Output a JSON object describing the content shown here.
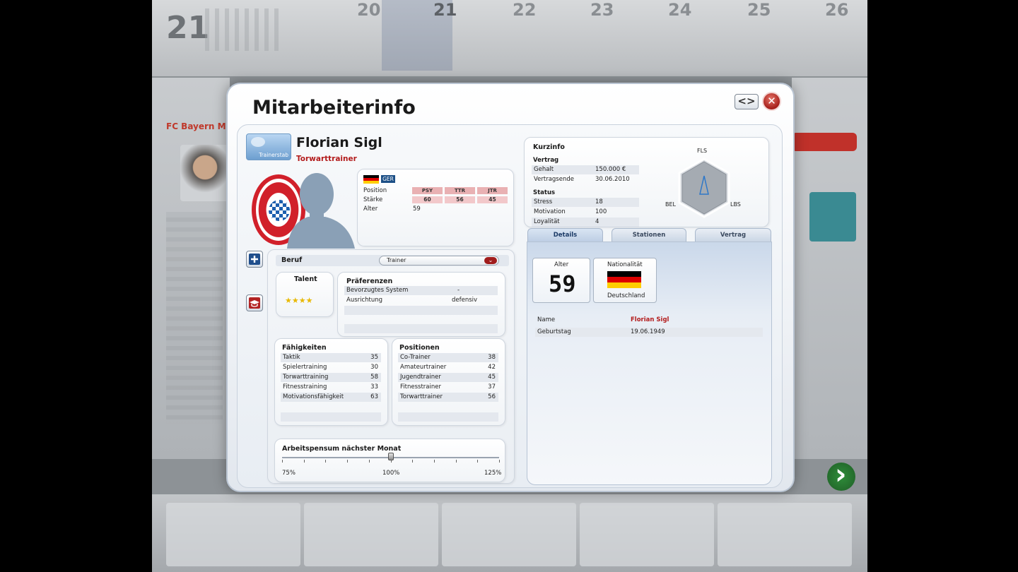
{
  "background": {
    "day_big": "21",
    "days": [
      "20",
      "21",
      "22",
      "23",
      "24",
      "25",
      "26"
    ],
    "club_title": "FC Bayern Mü"
  },
  "modal": {
    "title": "Mitarbeiterinfo",
    "nav_label": "<>",
    "close_label": "✕"
  },
  "header": {
    "badge_label": "Trainerstab",
    "name": "Florian Sigl",
    "role": "Torwarttrainer",
    "club_logo_text": "FC BAYERN MÜNCHEN"
  },
  "summary": {
    "nationality_code": "GER",
    "rows": [
      {
        "label": "Position"
      },
      {
        "label": "Stärke"
      },
      {
        "label": "Alter",
        "value": "59"
      }
    ],
    "attributes": [
      {
        "code": "PSY",
        "value": "60"
      },
      {
        "code": "TTR",
        "value": "56"
      },
      {
        "code": "JTR",
        "value": "45"
      }
    ]
  },
  "beruf": {
    "label": "Beruf",
    "value": "Trainer"
  },
  "talent": {
    "label": "Talent",
    "stars": 4,
    "stars_text": "★★★★"
  },
  "praeferenzen": {
    "title": "Präferenzen",
    "rows": [
      {
        "label": "Bevorzugtes System",
        "value": "-"
      },
      {
        "label": "Ausrichtung",
        "value": "defensiv"
      }
    ]
  },
  "faehigkeiten": {
    "title": "Fähigkeiten",
    "rows": [
      {
        "label": "Taktik",
        "value": "35"
      },
      {
        "label": "Spielertraining",
        "value": "30"
      },
      {
        "label": "Torwarttraining",
        "value": "58"
      },
      {
        "label": "Fitnesstraining",
        "value": "33"
      },
      {
        "label": "Motivationsfähigkeit",
        "value": "63"
      }
    ]
  },
  "positionen": {
    "title": "Positionen",
    "rows": [
      {
        "label": "Co-Trainer",
        "value": "38"
      },
      {
        "label": "Amateurtrainer",
        "value": "42"
      },
      {
        "label": "Jugendtrainer",
        "value": "45"
      },
      {
        "label": "Fitnesstrainer",
        "value": "37"
      },
      {
        "label": "Torwarttrainer",
        "value": "56"
      }
    ]
  },
  "arbeitspensum": {
    "title": "Arbeitspensum nächster Monat",
    "min_label": "75%",
    "mid_label": "100%",
    "max_label": "125%",
    "value_percent": 100
  },
  "kurzinfo": {
    "title": "Kurzinfo",
    "vertrag_title": "Vertrag",
    "vertrag_rows": [
      {
        "label": "Gehalt",
        "value": "150.000 €"
      },
      {
        "label": "Vertragsende",
        "value": "30.06.2010"
      }
    ],
    "status_title": "Status",
    "status_rows": [
      {
        "label": "Stress",
        "value": "18"
      },
      {
        "label": "Motivation",
        "value": "100"
      },
      {
        "label": "Loyalität",
        "value": "4"
      }
    ],
    "radar_labels": {
      "top": "FLS",
      "left": "BEL",
      "right": "LBS"
    }
  },
  "tabs": [
    {
      "label": "Details",
      "active": true
    },
    {
      "label": "Stationen",
      "active": false
    },
    {
      "label": "Vertrag",
      "active": false
    }
  ],
  "details": {
    "age_label": "Alter",
    "age_value": "59",
    "nationality_label": "Nationalität",
    "nationality_value": "Deutschland",
    "rows": [
      {
        "label": "Name",
        "value": "Florian Sigl"
      },
      {
        "label": "Geburtstag",
        "value": "19.06.1949"
      }
    ]
  },
  "colors": {
    "accent_red": "#b31b1b",
    "attr_header": "#e9b1b3",
    "close_button": "#a51e19",
    "tab_active": "#1b3a66"
  }
}
